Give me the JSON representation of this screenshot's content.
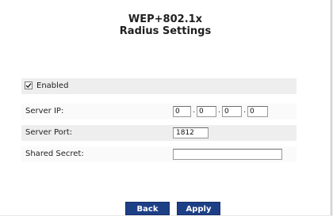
{
  "header": {
    "title_line1": "WEP+802.1x",
    "title_line2": "Radius Settings"
  },
  "enabled": {
    "label": "Enabled",
    "checked": true
  },
  "server_ip": {
    "label": "Server IP:",
    "octets": [
      "0",
      "0",
      "0",
      "0"
    ]
  },
  "server_port": {
    "label": "Server Port:",
    "value": "1812"
  },
  "shared_secret": {
    "label": "Shared Secret:",
    "value": ""
  },
  "buttons": {
    "back": "Back",
    "apply": "Apply"
  },
  "colors": {
    "button_bg": "#1d3f86",
    "row_gray": "#eeeeee",
    "row_white": "#fafafa"
  }
}
